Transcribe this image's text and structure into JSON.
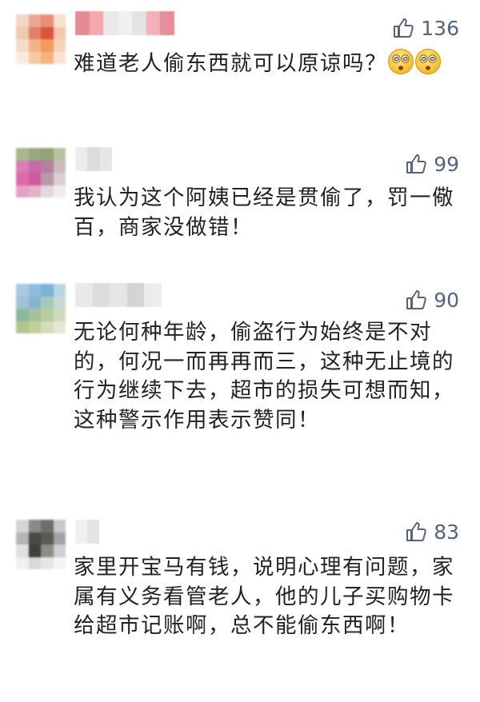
{
  "comments": [
    {
      "likes": "136",
      "text": "难道老人偷东西就可以原谅吗？",
      "emoji_icons": [
        "dizzy-face-emoji",
        "dizzy-face-emoji"
      ],
      "avatar_colors": [
        "#f2d7c9",
        "#e9a78f",
        "#e98f7a",
        "#f6e0d4",
        "#f0c9b3",
        "#e17f6a",
        "#d9533d",
        "#f3c7a9",
        "#f4dcc8",
        "#f0b48a",
        "#f39a5c",
        "#f5d3b8",
        "#f7ebe0",
        "#f6c9a3",
        "#f7b37c",
        "#f8e4d2"
      ],
      "name_colors": [
        "#e88a93",
        "#f2a8ad",
        "#e9e9e9",
        "#f0f0f0",
        "#e3e3e3",
        "#f3b0b8",
        "#e68d98"
      ]
    },
    {
      "likes": "99",
      "text": "我认为这个阿姨已经是贯偷了，罚一儆百，商家没做错！",
      "avatar_colors": [
        "#a7b88d",
        "#9aa87f",
        "#8fa575",
        "#b8c3a2",
        "#d67fb3",
        "#c868a4",
        "#b67fa0",
        "#c9bcc0",
        "#dc6aa8",
        "#cf5aa0",
        "#b89aa8",
        "#d8d0d3",
        "#e7a0c8",
        "#e1b3cd",
        "#e5d8dd",
        "#f0ecee"
      ],
      "name_colors": [
        "#ededed",
        "#dcdcdc",
        "#e6e6e6"
      ]
    },
    {
      "likes": "90",
      "text": "无论何种年龄，偷盗行为始终是不对的，何况一而再再而三，这种无止境的行为继续下去，超市的损失可想而知，这种警示作用表示赞同！",
      "avatar_colors": [
        "#a9c9e0",
        "#8fbde0",
        "#7fb2d8",
        "#b9d6e8",
        "#9cc3d9",
        "#86b6cf",
        "#a8c8b8",
        "#c5d9d0",
        "#8fb7a0",
        "#a6c29a",
        "#b8cc9e",
        "#cfd9c0",
        "#b3c58f",
        "#c2cf98",
        "#d5dcb8",
        "#e4e8d6"
      ],
      "name_colors": [
        "#e9e9e9",
        "#dcdcdc",
        "#e6e6e6",
        "#d4d4d4",
        "#ececec"
      ]
    },
    {
      "likes": "83",
      "text": "家里开宝马有钱，说明心理有问题，家属有义务看管老人，他的儿子买购物卡给超市记账啊，总不能偷东西啊！",
      "avatar_colors": [
        "#d5d5d5",
        "#8a8a8a",
        "#6e6e6e",
        "#c9c9c9",
        "#b5b5b5",
        "#4a4a48",
        "#5d5a52",
        "#a3a3a3",
        "#e0e0e0",
        "#3f3f3d",
        "#8f8d86",
        "#cfcfcf",
        "#f0f0f0",
        "#d9d9d9",
        "#e6e6e6",
        "#f5f5f5"
      ],
      "name_colors": [
        "#f0f0f0",
        "#e4e4e4"
      ]
    }
  ]
}
